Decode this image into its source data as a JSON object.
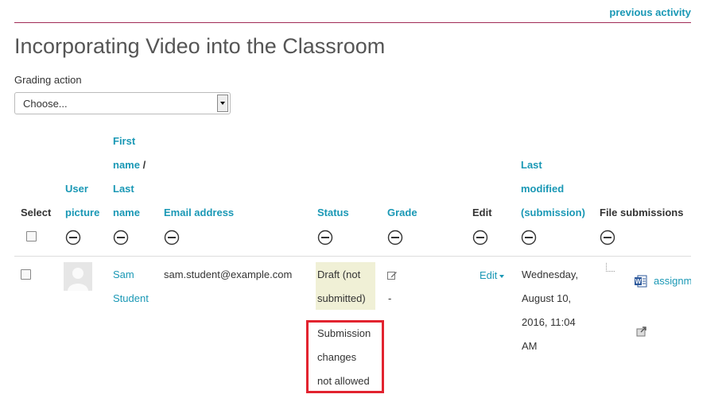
{
  "nav": {
    "previous_activity": "previous activity"
  },
  "page": {
    "title": "Incorporating Video into the Classroom"
  },
  "grading_action": {
    "label": "Grading action",
    "selected": "Choose..."
  },
  "columns": {
    "select": "Select",
    "user_picture": [
      "User",
      "picture"
    ],
    "name": [
      "First",
      "name",
      "/",
      "Last",
      "name"
    ],
    "email": "Email address",
    "status": "Status",
    "grade": "Grade",
    "edit": "Edit",
    "last_modified": [
      "Last",
      "modified",
      "(submission)"
    ],
    "file_submissions": "File submissions"
  },
  "row": {
    "first_name": "Sam",
    "last_name": "Student",
    "email": "sam.student@example.com",
    "status_lines": [
      "Draft (not",
      "submitted)"
    ],
    "submission_note_lines": [
      "Submission",
      "changes",
      "not allowed"
    ],
    "grade_value": "-",
    "edit_label": "Edit",
    "modified_lines": [
      "Wednesday,",
      "August 10,",
      "2016, 11:04",
      "AM"
    ],
    "file_name": "assignm"
  },
  "colors": {
    "link": "#1a98b5",
    "rule": "#a02a56",
    "highlight_border": "#e2232f",
    "status_bg": "#f0f0d6"
  },
  "icons": {
    "hide_column": "minus-circle-icon",
    "grade": "pencil-edit-icon",
    "file": "word-document-icon",
    "portfolio": "export-to-portfolio-icon",
    "avatar": "default-user-avatar"
  }
}
